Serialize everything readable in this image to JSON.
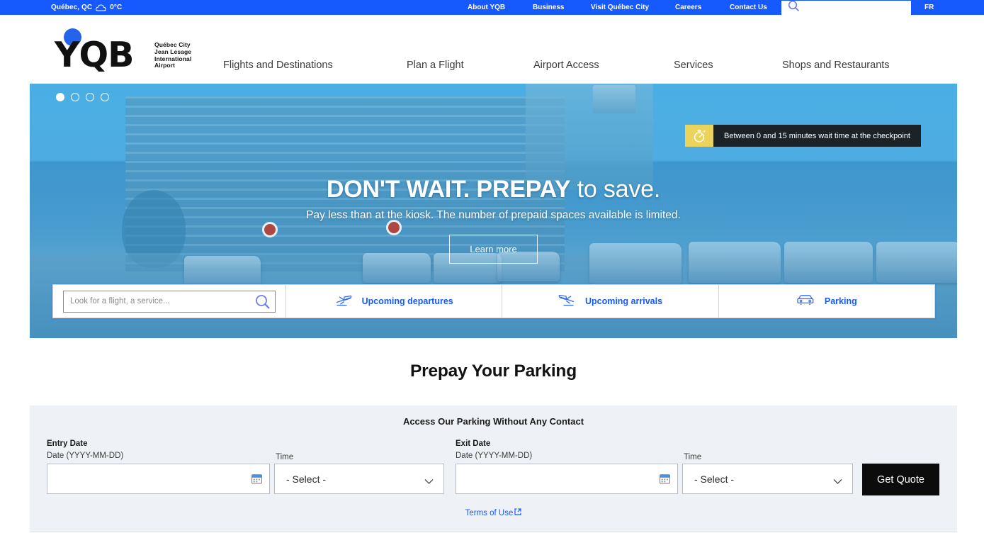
{
  "topbar": {
    "weather_location": "Québec, QC",
    "weather_temp": "0°C",
    "weather_icon": "cloud-icon",
    "links": [
      {
        "label": "About YQB"
      },
      {
        "label": "Business"
      },
      {
        "label": "Visit Québec City"
      },
      {
        "label": "Careers"
      },
      {
        "label": "Contact Us"
      }
    ],
    "search_placeholder": "",
    "search_icon": "search-icon",
    "language": "FR",
    "bg_color": "#1559ff"
  },
  "logo": {
    "wordmark": "YQB",
    "subtitle_lines": [
      "Québec City",
      "Jean Lesage",
      "International",
      "Airport"
    ],
    "dot_color": "#2563eb"
  },
  "mainnav": {
    "items": [
      {
        "label": "Flights and Destinations"
      },
      {
        "label": "Plan a Flight"
      },
      {
        "label": "Airport Access"
      },
      {
        "label": "Services"
      },
      {
        "label": "Shops and Restaurants"
      }
    ]
  },
  "hero": {
    "carousel": {
      "total": 4,
      "active_index": 0
    },
    "wait_time": {
      "icon": "stopwatch-icon",
      "text": "Between 0 and 15 minutes wait time at the checkpoint",
      "icon_bg": "#ecd45c",
      "text_bg": "#1b2228"
    },
    "title_strong": "DON'T WAIT. PREPAY",
    "title_rest": " to save.",
    "subtitle": "Pay less than at the kiosk. The number of prepaid spaces available is limited.",
    "cta_label": "Learn more"
  },
  "quickbar": {
    "search_placeholder": "Look for a flight, a service...",
    "search_value": "",
    "search_icon": "search-icon",
    "items": [
      {
        "label": "Upcoming departures",
        "icon": "airplane-departure-icon"
      },
      {
        "label": "Upcoming arrivals",
        "icon": "airplane-arrival-icon"
      },
      {
        "label": "Parking",
        "icon": "car-icon"
      }
    ],
    "accent_color": "#1559ff"
  },
  "prepay": {
    "title": "Prepay Your Parking",
    "subtitle": "Access Our Parking Without Any Contact",
    "entry": {
      "group_label": "Entry Date",
      "date_label": "Date (YYYY-MM-DD)",
      "date_value": "",
      "time_label": "Time",
      "time_value": "- Select -"
    },
    "exit": {
      "group_label": "Exit Date",
      "date_label": "Date (YYYY-MM-DD)",
      "date_value": "",
      "time_label": "Time",
      "time_value": "- Select -"
    },
    "quote_button": "Get Quote",
    "terms_label": "Terms of Use",
    "terms_icon": "external-link-icon",
    "button_bg": "#0c0c0c",
    "band_bg": "#eef1f6"
  }
}
